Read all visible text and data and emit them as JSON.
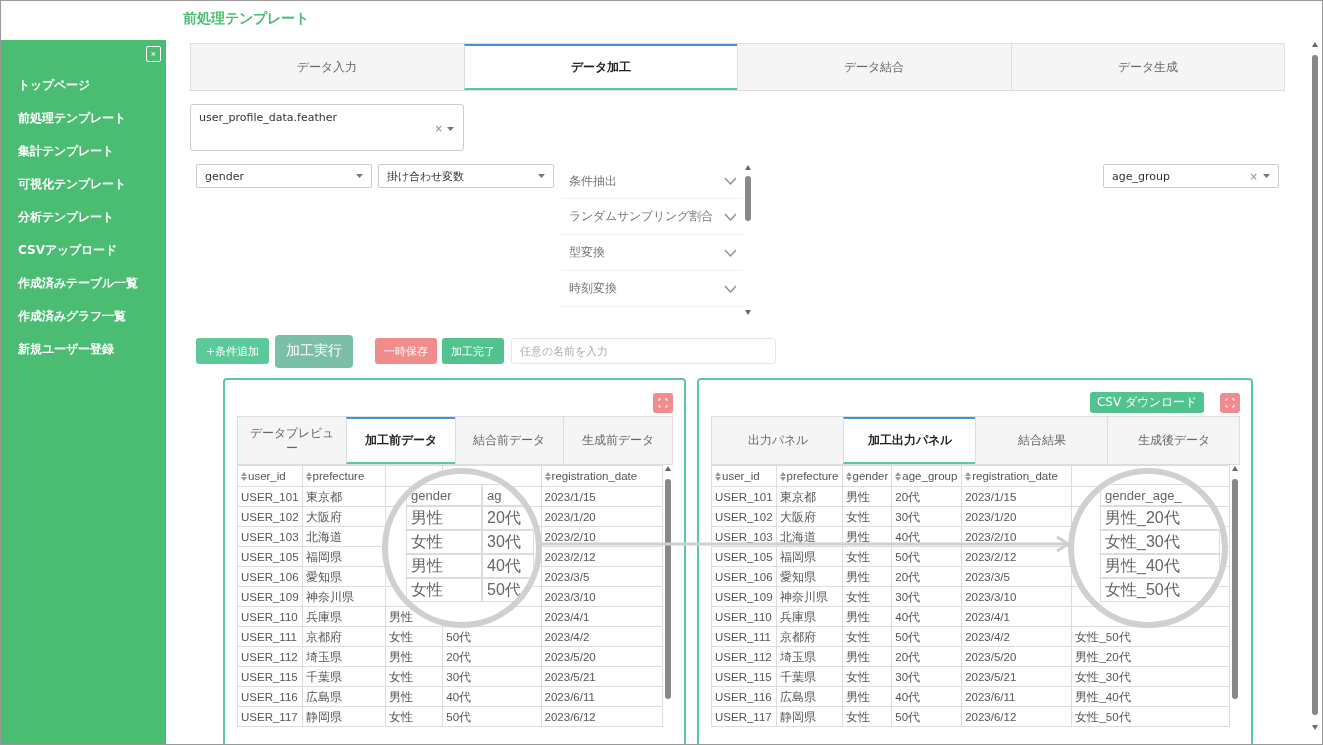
{
  "page_title": "前処理テンプレート",
  "sidebar": {
    "close": "×",
    "items": [
      {
        "label": "トップページ"
      },
      {
        "label": "前処理テンプレート"
      },
      {
        "label": "集計テンプレート"
      },
      {
        "label": "可視化テンプレート"
      },
      {
        "label": "分析テンプレート"
      },
      {
        "label": "CSVアップロード"
      },
      {
        "label": "作成済みテーブル一覧"
      },
      {
        "label": "作成済みグラフ一覧"
      },
      {
        "label": "新規ユーザー登録"
      }
    ]
  },
  "tabs": [
    {
      "label": "データ入力",
      "selected": false
    },
    {
      "label": "データ加工",
      "selected": true
    },
    {
      "label": "データ結合",
      "selected": false
    },
    {
      "label": "データ生成",
      "selected": false
    }
  ],
  "file_select": {
    "value": "user_profile_data.feather",
    "clear": "×"
  },
  "variable_selects": [
    {
      "value": "gender"
    },
    {
      "value": "掛け合わせ変数"
    }
  ],
  "operations": [
    {
      "label": "条件抽出",
      "expanded": false
    },
    {
      "label": "ランダムサンプリング割合",
      "expanded": false
    },
    {
      "label": "型変換",
      "expanded": false
    },
    {
      "label": "時刻変換",
      "expanded": false
    }
  ],
  "output_select": {
    "value": "age_group",
    "clear": "×"
  },
  "buttons": [
    {
      "label": "+条件追加",
      "kind": "add"
    },
    {
      "label": "加工実行",
      "kind": "run"
    },
    {
      "label": "一時保存",
      "kind": "save"
    },
    {
      "label": "加工完了",
      "kind": "done"
    }
  ],
  "name_field": {
    "placeholder": "任意の名前を入力"
  },
  "panels": [
    {
      "tabs": [
        {
          "label": "データプレビュー",
          "selected": false
        },
        {
          "label": "加工前データ",
          "selected": true
        },
        {
          "label": "結合前データ",
          "selected": false
        },
        {
          "label": "生成前データ",
          "selected": false
        }
      ],
      "columns": [
        "user_id",
        "prefecture",
        null,
        null,
        "registration_date"
      ],
      "rows": [
        [
          "USER_101",
          "東京都",
          null,
          null,
          "2023/1/15"
        ],
        [
          "USER_102",
          "大阪府",
          null,
          null,
          "2023/1/20"
        ],
        [
          "USER_103",
          "北海道",
          null,
          null,
          "2023/2/10"
        ],
        [
          "USER_105",
          "福岡県",
          null,
          null,
          "2023/2/12"
        ],
        [
          "USER_106",
          "愛知県",
          null,
          null,
          "2023/3/5"
        ],
        [
          "USER_109",
          "神奈川県",
          null,
          null,
          "2023/3/10"
        ],
        [
          "USER_110",
          "兵庫県",
          "男性",
          null,
          "2023/4/1"
        ],
        [
          "USER_111",
          "京都府",
          "女性",
          "50代",
          "2023/4/2"
        ],
        [
          "USER_112",
          "埼玉県",
          "男性",
          "20代",
          "2023/5/20"
        ],
        [
          "USER_115",
          "千葉県",
          "女性",
          "30代",
          "2023/5/21"
        ],
        [
          "USER_116",
          "広島県",
          "男性",
          "40代",
          "2023/6/11"
        ],
        [
          "USER_117",
          "静岡県",
          "女性",
          "50代",
          "2023/6/12"
        ]
      ],
      "magnifier": {
        "columns": [
          "gender",
          "ag"
        ],
        "rows": [
          [
            "男性",
            "20代"
          ],
          [
            "女性",
            "30代"
          ],
          [
            "男性",
            "40代"
          ],
          [
            "女性",
            "50代"
          ]
        ]
      }
    },
    {
      "download_button": "CSV ダウンロード",
      "tabs": [
        {
          "label": "出力パネル",
          "selected": false
        },
        {
          "label": "加工出力パネル",
          "selected": true
        },
        {
          "label": "結合結果",
          "selected": false
        },
        {
          "label": "生成後データ",
          "selected": false
        }
      ],
      "columns": [
        "user_id",
        "prefecture",
        "gender",
        "age_group",
        "registration_date",
        null
      ],
      "rows": [
        [
          "USER_101",
          "東京都",
          "男性",
          "20代",
          "2023/1/15",
          null
        ],
        [
          "USER_102",
          "大阪府",
          "女性",
          "30代",
          "2023/1/20",
          null
        ],
        [
          "USER_103",
          "北海道",
          "男性",
          "40代",
          "2023/2/10",
          null
        ],
        [
          "USER_105",
          "福岡県",
          "女性",
          "50代",
          "2023/2/12",
          null
        ],
        [
          "USER_106",
          "愛知県",
          "男性",
          "20代",
          "2023/3/5",
          null
        ],
        [
          "USER_109",
          "神奈川県",
          "女性",
          "30代",
          "2023/3/10",
          null
        ],
        [
          "USER_110",
          "兵庫県",
          "男性",
          "40代",
          "2023/4/1",
          null
        ],
        [
          "USER_111",
          "京都府",
          "女性",
          "50代",
          "2023/4/2",
          "女性_50代"
        ],
        [
          "USER_112",
          "埼玉県",
          "男性",
          "20代",
          "2023/5/20",
          "男性_20代"
        ],
        [
          "USER_115",
          "千葉県",
          "女性",
          "30代",
          "2023/5/21",
          "女性_30代"
        ],
        [
          "USER_116",
          "広島県",
          "男性",
          "40代",
          "2023/6/11",
          "男性_40代"
        ],
        [
          "USER_117",
          "静岡県",
          "女性",
          "50代",
          "2023/6/12",
          "女性_50代"
        ]
      ],
      "magnifier": {
        "columns": [
          "gender_age_"
        ],
        "rows": [
          [
            "男性_20代"
          ],
          [
            "女性_30代"
          ],
          [
            "男性_40代"
          ],
          [
            "女性_50代"
          ]
        ]
      }
    }
  ]
}
